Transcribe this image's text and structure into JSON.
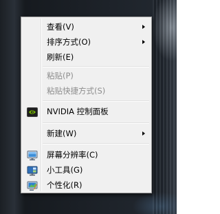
{
  "context_menu": {
    "items": [
      {
        "label": "查看(V)",
        "submenu": true,
        "enabled": true
      },
      {
        "label": "排序方式(O)",
        "submenu": true,
        "enabled": true
      },
      {
        "label": "刷新(E)",
        "submenu": false,
        "enabled": true
      },
      {
        "label": "粘贴(P)",
        "submenu": false,
        "enabled": false
      },
      {
        "label": "粘贴快捷方式(S)",
        "submenu": false,
        "enabled": false
      },
      {
        "label": "NVIDIA 控制面板",
        "submenu": false,
        "enabled": true,
        "icon": "nvidia-icon"
      },
      {
        "label": "新建(W)",
        "submenu": true,
        "enabled": true
      },
      {
        "label": "屏幕分辨率(C)",
        "submenu": false,
        "enabled": true,
        "icon": "monitor-resolution-icon"
      },
      {
        "label": "小工具(G)",
        "submenu": false,
        "enabled": true,
        "icon": "gadgets-icon"
      },
      {
        "label": "个性化(R)",
        "submenu": false,
        "enabled": true,
        "icon": "personalize-icon"
      }
    ]
  },
  "colors": {
    "menu_bg": "#f0f0f0",
    "menu_border": "#979797",
    "disabled_text": "#8d8d8d",
    "nvidia_green": "#76b900"
  }
}
